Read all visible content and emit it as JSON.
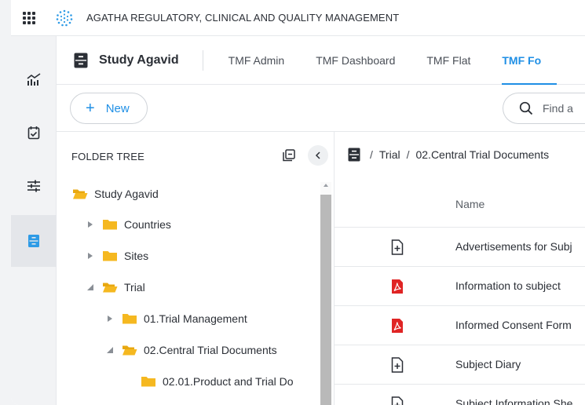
{
  "app": {
    "title": "AGATHA REGULATORY, CLINICAL AND QUALITY MANAGEMENT"
  },
  "rail": {
    "items": [
      {
        "icon": "analytics-icon"
      },
      {
        "icon": "calendar-check-icon"
      },
      {
        "icon": "sliders-icon"
      },
      {
        "icon": "archive-icon",
        "active": true
      }
    ]
  },
  "header": {
    "study_name": "Study Agavid",
    "tabs": [
      {
        "label": "TMF Admin"
      },
      {
        "label": "TMF Dashboard"
      },
      {
        "label": "TMF Flat"
      },
      {
        "label": "TMF Fo",
        "active": true
      }
    ]
  },
  "toolbar": {
    "new_label": "New",
    "search_placeholder": "Find a"
  },
  "tree": {
    "title": "FOLDER TREE",
    "items": [
      {
        "label": "Study Agavid",
        "state": "open"
      },
      {
        "label": "Countries",
        "state": "collapsed"
      },
      {
        "label": "Sites",
        "state": "collapsed"
      },
      {
        "label": "Trial",
        "state": "expanded"
      },
      {
        "label": "01.Trial Management",
        "state": "collapsed"
      },
      {
        "label": "02.Central Trial Documents",
        "state": "expanded"
      },
      {
        "label": "02.01.Product and Trial Do",
        "state": "leaf"
      }
    ]
  },
  "docs": {
    "breadcrumb": [
      "Trial",
      "02.Central Trial Documents"
    ],
    "column_name": "Name",
    "rows": [
      {
        "name": "Advertisements for Subj",
        "type": "generic"
      },
      {
        "name": "Information to subject",
        "type": "pdf"
      },
      {
        "name": "Informed Consent Form",
        "type": "pdf"
      },
      {
        "name": "Subject Diary",
        "type": "generic"
      },
      {
        "name": "Subject Information She",
        "type": "generic"
      }
    ]
  },
  "colors": {
    "accent": "#1f8fe5",
    "folder": "#f5b820",
    "pdf": "#e02424"
  }
}
